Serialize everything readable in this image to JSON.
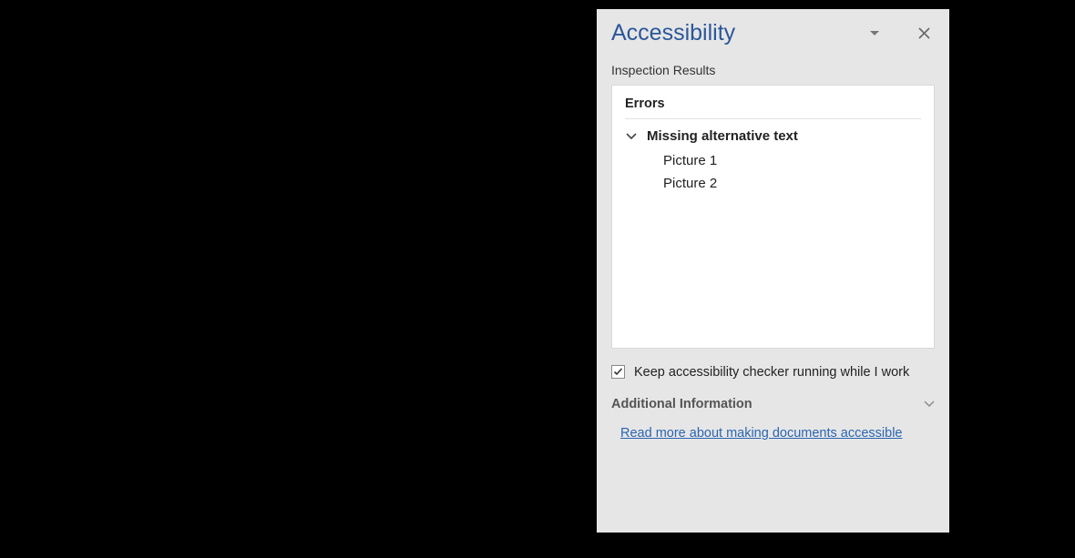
{
  "pane": {
    "title": "Accessibility",
    "section_label": "Inspection Results",
    "errors_heading": "Errors",
    "error_group": {
      "title": "Missing alternative text",
      "items": [
        "Picture 1",
        "Picture 2"
      ]
    },
    "checkbox_label": "Keep accessibility checker running while I work",
    "checkbox_checked": true,
    "additional_info_label": "Additional Information",
    "link_text": "Read more about making documents accessible"
  }
}
